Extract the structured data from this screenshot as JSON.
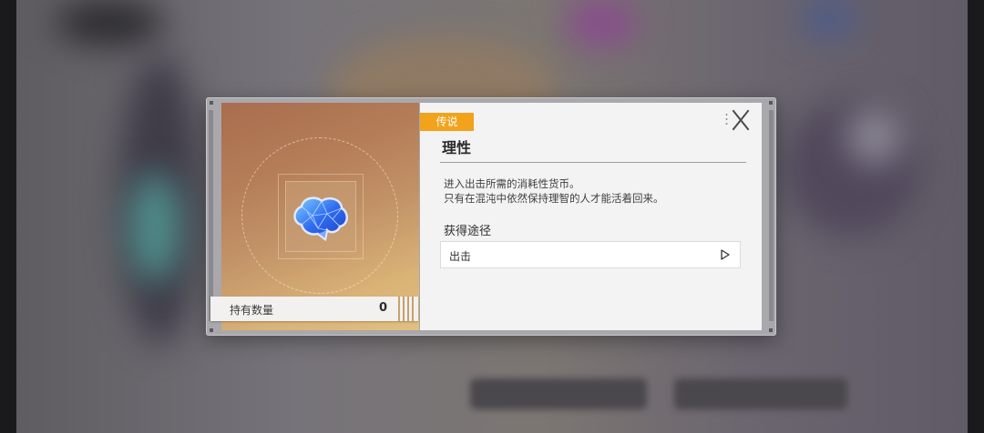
{
  "item": {
    "rarity": "传说",
    "name": "理性",
    "description_lines": [
      "进入出击所需的消耗性货币。",
      "只有在混沌中依然保持理智的人才能活着回来。"
    ],
    "quantity_label": "持有数量",
    "quantity": "0",
    "icon": "brain-crystal-icon"
  },
  "acquire": {
    "section_title": "获得途径",
    "sources": [
      {
        "label": "出击",
        "icon": "play-arrow-icon"
      }
    ]
  },
  "controls": {
    "close_icon": "close-icon"
  },
  "colors": {
    "rarity_badge": "#f2a21b",
    "panel_bg": "#f3f3f3",
    "card_gradient_start": "#a86d4e",
    "card_gradient_end": "#e2bf80"
  }
}
